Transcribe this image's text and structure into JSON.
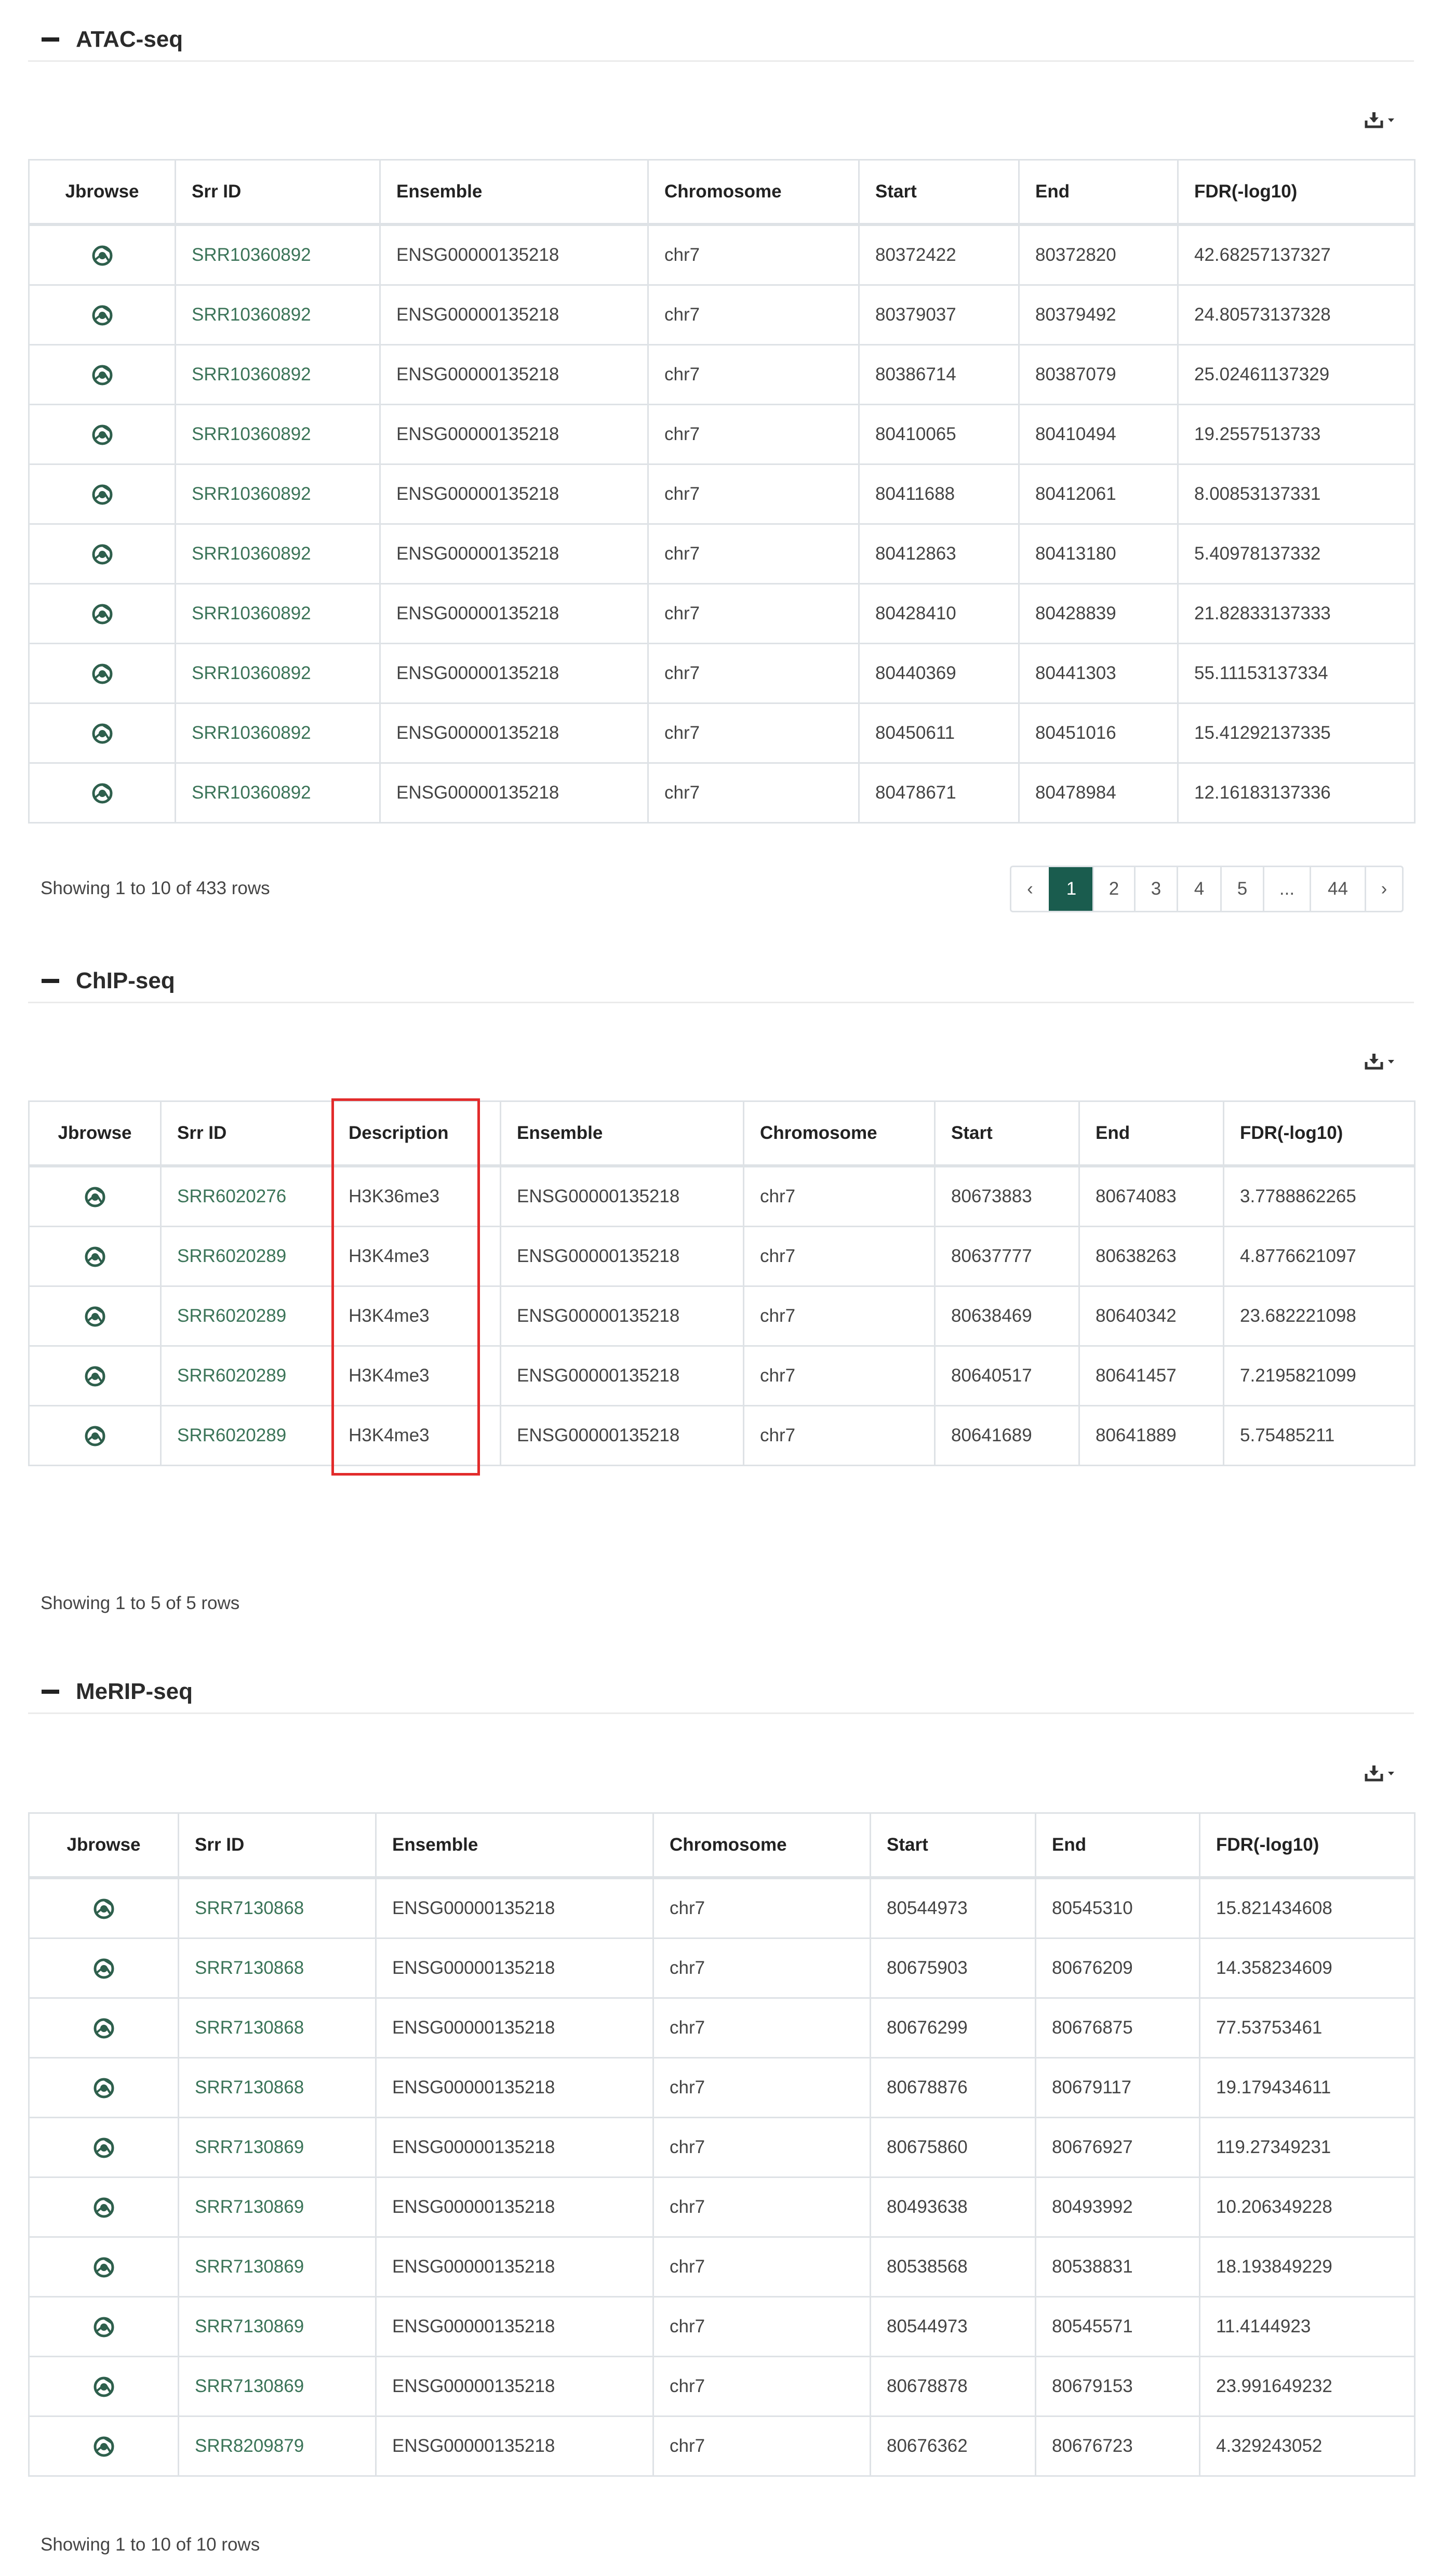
{
  "theme": {
    "link_color": "#3b7458",
    "active_page_color": "#1a5c4e",
    "highlight_color": "#e22b2b"
  },
  "atac": {
    "title": "ATAC-seq",
    "columns": [
      "Jbrowse",
      "Srr ID",
      "Ensemble",
      "Chromosome",
      "Start",
      "End",
      "FDR(-log10)"
    ],
    "rows": [
      [
        "SRR10360892",
        "ENSG00000135218",
        "chr7",
        "80372422",
        "80372820",
        "42.68257137327"
      ],
      [
        "SRR10360892",
        "ENSG00000135218",
        "chr7",
        "80379037",
        "80379492",
        "24.80573137328"
      ],
      [
        "SRR10360892",
        "ENSG00000135218",
        "chr7",
        "80386714",
        "80387079",
        "25.02461137329"
      ],
      [
        "SRR10360892",
        "ENSG00000135218",
        "chr7",
        "80410065",
        "80410494",
        "19.2557513733"
      ],
      [
        "SRR10360892",
        "ENSG00000135218",
        "chr7",
        "80411688",
        "80412061",
        "8.00853137331"
      ],
      [
        "SRR10360892",
        "ENSG00000135218",
        "chr7",
        "80412863",
        "80413180",
        "5.40978137332"
      ],
      [
        "SRR10360892",
        "ENSG00000135218",
        "chr7",
        "80428410",
        "80428839",
        "21.82833137333"
      ],
      [
        "SRR10360892",
        "ENSG00000135218",
        "chr7",
        "80440369",
        "80441303",
        "55.11153137334"
      ],
      [
        "SRR10360892",
        "ENSG00000135218",
        "chr7",
        "80450611",
        "80451016",
        "15.41292137335"
      ],
      [
        "SRR10360892",
        "ENSG00000135218",
        "chr7",
        "80478671",
        "80478984",
        "12.16183137336"
      ]
    ],
    "summary": "Showing 1 to 10 of 433 rows",
    "pagination": [
      "‹",
      "1",
      "2",
      "3",
      "4",
      "5",
      "...",
      "44",
      "›"
    ],
    "current_page": "1"
  },
  "chip": {
    "title": "ChIP-seq",
    "columns": [
      "Jbrowse",
      "Srr ID",
      "Description",
      "Ensemble",
      "Chromosome",
      "Start",
      "End",
      "FDR(-log10)"
    ],
    "rows": [
      [
        "SRR6020276",
        "H3K36me3",
        "ENSG00000135218",
        "chr7",
        "80673883",
        "80674083",
        "3.7788862265"
      ],
      [
        "SRR6020289",
        "H3K4me3",
        "ENSG00000135218",
        "chr7",
        "80637777",
        "80638263",
        "4.8776621097"
      ],
      [
        "SRR6020289",
        "H3K4me3",
        "ENSG00000135218",
        "chr7",
        "80638469",
        "80640342",
        "23.682221098"
      ],
      [
        "SRR6020289",
        "H3K4me3",
        "ENSG00000135218",
        "chr7",
        "80640517",
        "80641457",
        "7.2195821099"
      ],
      [
        "SRR6020289",
        "H3K4me3",
        "ENSG00000135218",
        "chr7",
        "80641689",
        "80641889",
        "5.75485211"
      ]
    ],
    "summary": "Showing 1 to 5 of 5 rows"
  },
  "merip": {
    "title": "MeRIP-seq",
    "columns": [
      "Jbrowse",
      "Srr ID",
      "Ensemble",
      "Chromosome",
      "Start",
      "End",
      "FDR(-log10)"
    ],
    "rows": [
      [
        "SRR7130868",
        "ENSG00000135218",
        "chr7",
        "80544973",
        "80545310",
        "15.821434608"
      ],
      [
        "SRR7130868",
        "ENSG00000135218",
        "chr7",
        "80675903",
        "80676209",
        "14.358234609"
      ],
      [
        "SRR7130868",
        "ENSG00000135218",
        "chr7",
        "80676299",
        "80676875",
        "77.53753461"
      ],
      [
        "SRR7130868",
        "ENSG00000135218",
        "chr7",
        "80678876",
        "80679117",
        "19.179434611"
      ],
      [
        "SRR7130869",
        "ENSG00000135218",
        "chr7",
        "80675860",
        "80676927",
        "119.27349231"
      ],
      [
        "SRR7130869",
        "ENSG00000135218",
        "chr7",
        "80493638",
        "80493992",
        "10.206349228"
      ],
      [
        "SRR7130869",
        "ENSG00000135218",
        "chr7",
        "80538568",
        "80538831",
        "18.193849229"
      ],
      [
        "SRR7130869",
        "ENSG00000135218",
        "chr7",
        "80544973",
        "80545571",
        "11.4144923"
      ],
      [
        "SRR7130869",
        "ENSG00000135218",
        "chr7",
        "80678878",
        "80679153",
        "23.991649232"
      ],
      [
        "SRR8209879",
        "ENSG00000135218",
        "chr7",
        "80676362",
        "80676723",
        "4.329243052"
      ]
    ],
    "summary": "Showing 1 to 10 of 10 rows"
  }
}
